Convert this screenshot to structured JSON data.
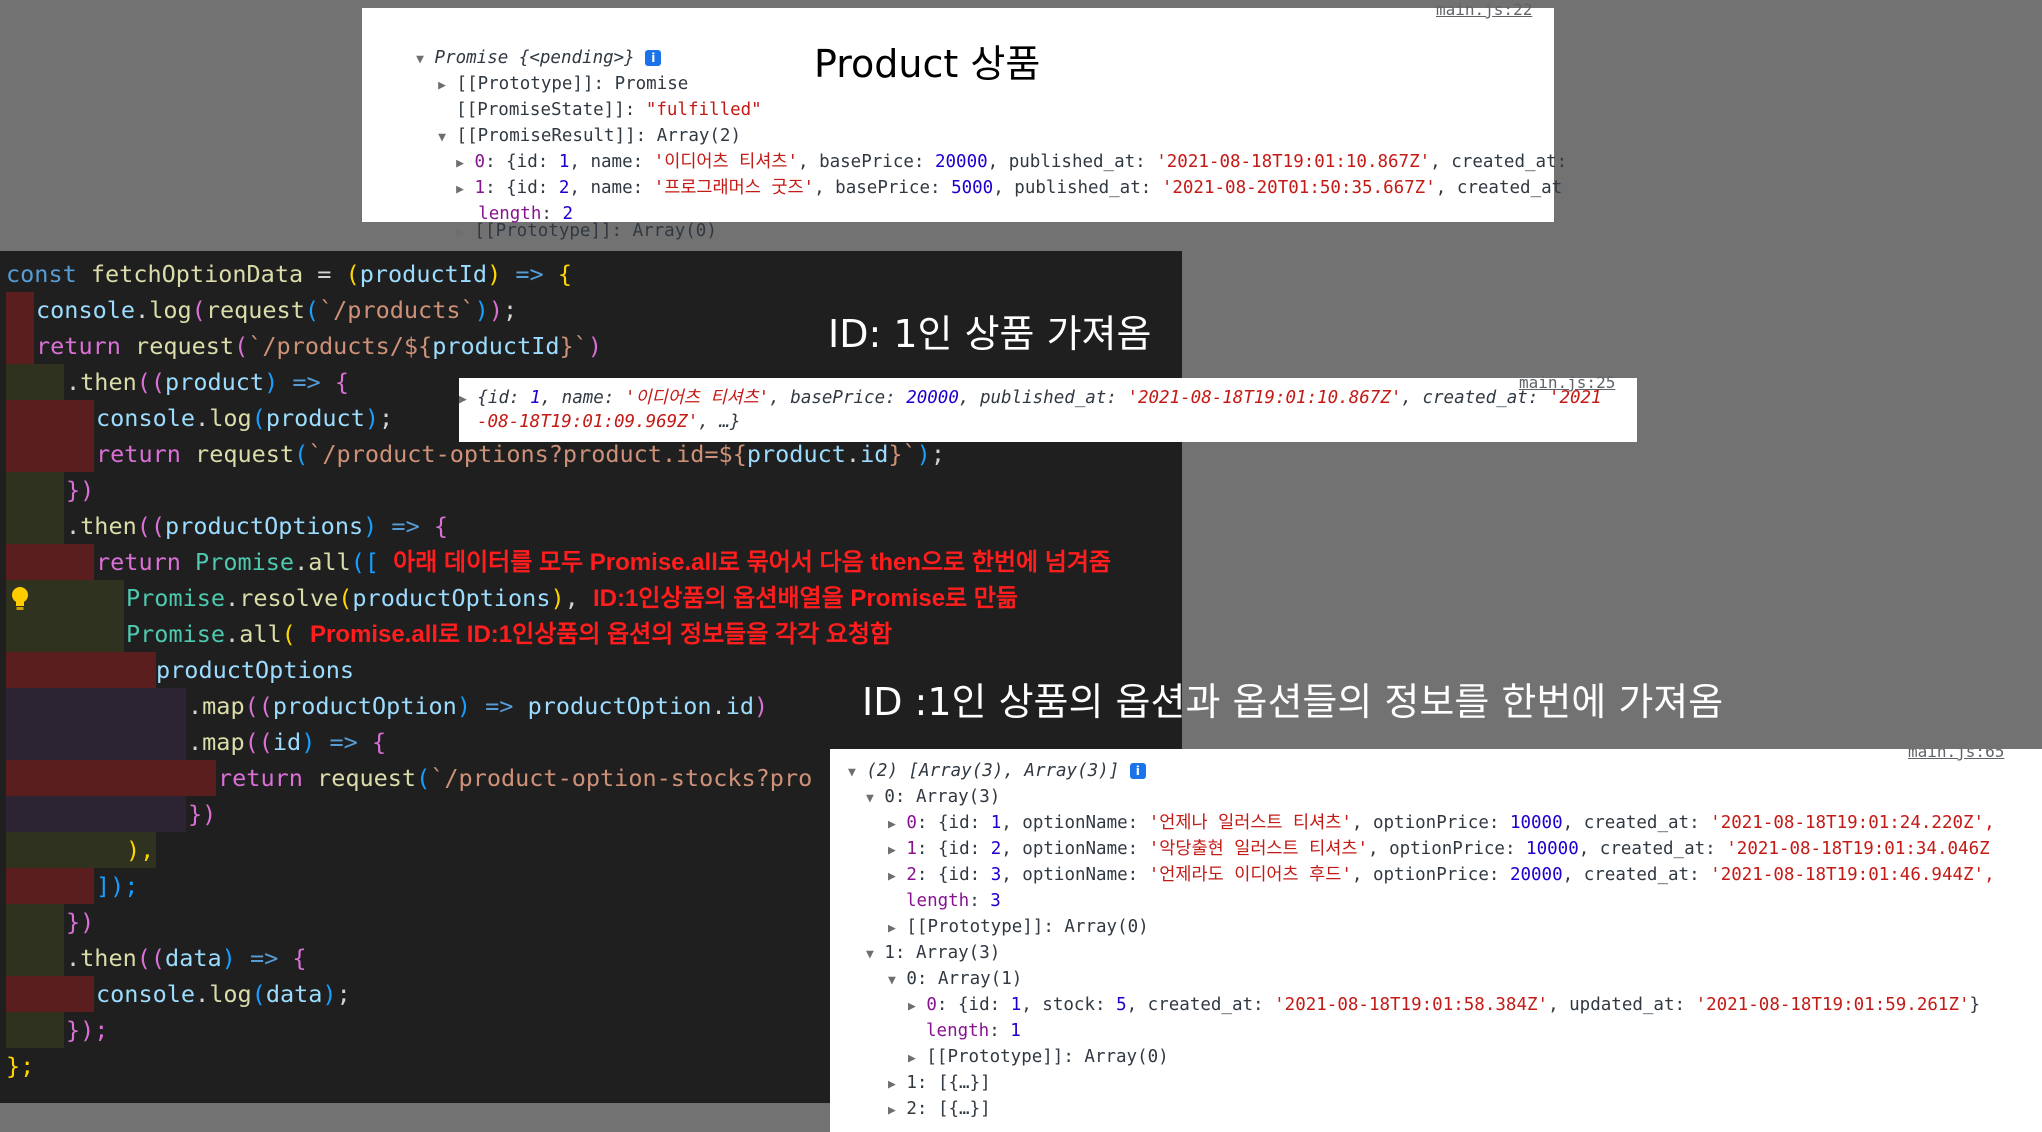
{
  "captions": {
    "product": "Product 상품",
    "id1_product": "ID: 1인 상품 가져옴",
    "id1_options": "ID :1인 상품의 옵션과 옵션들의 정보를 한번에 가져옴"
  },
  "console_top": {
    "source_link": "main.js:22",
    "promise_label": "Promise ",
    "promise_state_preview": "{<pending>}",
    "prototype_line": "[[Prototype]]: Promise",
    "promise_state_key": "[[PromiseState]]: ",
    "promise_state_value": "\"fulfilled\"",
    "promise_result_key": "[[PromiseResult]]: ",
    "promise_result_value": "Array(2)",
    "items": [
      {
        "idx": "0",
        "id": "1",
        "name": "'이디어츠 티셔츠'",
        "basePrice": "20000",
        "published_at": "'2021-08-18T19:01:10.867Z'",
        "tail": ", created_at:"
      },
      {
        "idx": "1",
        "id": "2",
        "name": "'프로그래머스 굿즈'",
        "basePrice": "5000",
        "published_at": "'2021-08-20T01:50:35.667Z'",
        "tail": ", created_at"
      }
    ],
    "length_key": "length",
    "length_value": "2",
    "array_proto": "[[Prototype]]: Array(0)"
  },
  "console_mid": {
    "source_link": "main.js:25",
    "line1_pre": "{id: ",
    "id": "1",
    "name_key": ", name: ",
    "name": "'이디어츠 티셔츠'",
    "price_key": ", basePrice: ",
    "price": "20000",
    "pub_key": ", published_at: ",
    "pub": "'2021-08-18T19:01:10.867Z'",
    "created_key": ", created_at: ",
    "created_part1": "'2021",
    "created_part2": "-08-18T19:01:09.969Z'",
    "tail": ", …}"
  },
  "console_bottom": {
    "source_link": "main.js:65",
    "header": "(2) [Array(3), Array(3)]",
    "group0": "0: Array(3)",
    "options": [
      {
        "idx": "0",
        "id": "1",
        "name": "'언제나 일러스트 티셔츠'",
        "price": "10000",
        "created": "'2021-08-18T19:01:24.220Z',"
      },
      {
        "idx": "1",
        "id": "2",
        "name": "'악당출현 일러스트 티셔츠'",
        "price": "10000",
        "created": "'2021-08-18T19:01:34.046Z"
      },
      {
        "idx": "2",
        "id": "3",
        "name": "'언제라도 이디어츠 후드'",
        "price": "20000",
        "created": "'2021-08-18T19:01:46.944Z',"
      }
    ],
    "length_key": "length",
    "length_value": "3",
    "proto": "[[Prototype]]: Array(0)",
    "group1": "1: Array(3)",
    "sub0": "0: Array(1)",
    "stock": {
      "idx": "0",
      "id": "1",
      "stock": "5",
      "created": "'2021-08-18T19:01:58.384Z'",
      "updated": "'2021-08-18T19:01:59.261Z'"
    },
    "sub_length_value": "1",
    "sub_proto": "[[Prototype]]: Array(0)",
    "row1": "1: [{…}]",
    "row2": "2: [{…}]"
  },
  "code": {
    "l1": [
      "const ",
      "fetchOptionData",
      " = ",
      "(",
      "productId",
      ") => ",
      "{"
    ],
    "l2": [
      "console",
      ".",
      "log",
      "(",
      "request",
      "(",
      "`/products`",
      "));"
    ],
    "l3": [
      "return ",
      "request",
      "(",
      "`/products/${",
      "productId",
      "}`",
      ")"
    ],
    "l4": [
      ".",
      "then",
      "((",
      "product",
      ") => ",
      "{"
    ],
    "l5": [
      "console",
      ".",
      "log",
      "(",
      "product",
      ");"
    ],
    "l6": [
      "return ",
      "request",
      "(",
      "`/product-options?product.id=${",
      "product",
      ".",
      "id",
      "}`",
      ");"
    ],
    "l7": "})",
    "l8": [
      ".",
      "then",
      "((",
      "productOptions",
      ") => ",
      "{"
    ],
    "l9": [
      "return ",
      "Promise",
      ".",
      "all",
      "(["
    ],
    "l10": [
      "Promise",
      ".",
      "resolve",
      "(",
      "productOptions",
      "),"
    ],
    "l11": [
      "Promise",
      ".",
      "all",
      "("
    ],
    "l12": "productOptions",
    "l13": [
      ".",
      "map",
      "((",
      "productOption",
      ") => ",
      "productOption",
      ".",
      "id",
      ")"
    ],
    "l14": [
      ".",
      "map",
      "((",
      "id",
      ") => ",
      "{"
    ],
    "l15": [
      "return ",
      "request",
      "(",
      "`/product-option-stocks?pro"
    ],
    "l16": "})",
    "l17": "),",
    "l18": "]);",
    "l19": "})",
    "l20": [
      ".",
      "then",
      "((",
      "data",
      ") => ",
      "{"
    ],
    "l21": [
      "console",
      ".",
      "log",
      "(",
      "data",
      ");"
    ],
    "l22": "});",
    "l23": "};"
  },
  "annotations": {
    "a1": "아래 데이터를 모두 Promise.all로 묶어서 다음 then으로 한번에 넘겨줌",
    "a2": "ID:1인상품의 옵션배열을 Promise로 만듦",
    "a3": "Promise.all로 ID:1인상품의 옵션의 정보들을 각각 요청함"
  },
  "colors": {
    "background": "#727272",
    "editor_bg": "#1f1f1f",
    "annotation_red": "#ff1d1d",
    "console_string": "#c41a16",
    "console_number": "#1c00cf",
    "console_key": "#881391"
  }
}
